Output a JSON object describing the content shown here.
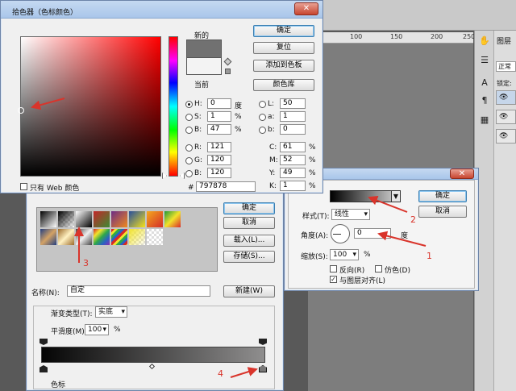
{
  "photoshop": {
    "ruler_ticks": [
      "100",
      "150",
      "200",
      "250"
    ],
    "tool_labels": [
      "A",
      "¶"
    ],
    "layers_labels": [
      "图层",
      "正常",
      "锁定:"
    ]
  },
  "color_picker": {
    "title": "拾色器（色标颜色）",
    "close_label": "✕",
    "new_label": "新的",
    "current_label": "当前",
    "buttons": {
      "ok": "确定",
      "reset": "复位",
      "add_to_swatches": "添加到色板",
      "color_libraries": "颜色库"
    },
    "web_only_label": "只有 Web 颜色",
    "new_color": "#717171",
    "current_color": "#f3f3f3",
    "hue_color": "#ff0000",
    "hsb": [
      {
        "key": "H:",
        "value": "0",
        "unit": "度",
        "selected": true
      },
      {
        "key": "S:",
        "value": "1",
        "unit": "%",
        "selected": false
      },
      {
        "key": "B:",
        "value": "47",
        "unit": "%",
        "selected": false
      }
    ],
    "rgb": [
      {
        "key": "R:",
        "value": "121"
      },
      {
        "key": "G:",
        "value": "120"
      },
      {
        "key": "B:",
        "value": "120"
      }
    ],
    "lab": [
      {
        "key": "L:",
        "value": "50"
      },
      {
        "key": "a:",
        "value": "1"
      },
      {
        "key": "b:",
        "value": "0"
      }
    ],
    "cmyk": [
      {
        "key": "C:",
        "value": "61",
        "unit": "%"
      },
      {
        "key": "M:",
        "value": "52",
        "unit": "%"
      },
      {
        "key": "Y:",
        "value": "49",
        "unit": "%"
      },
      {
        "key": "K:",
        "value": "1",
        "unit": "%"
      }
    ],
    "hex_label": "#",
    "hex_value": "797878"
  },
  "gradient_editor": {
    "buttons": {
      "ok": "确定",
      "cancel": "取消",
      "load": "载入(L)...",
      "save": "存储(S)...",
      "new": "新建(W)"
    },
    "name_label": "名称(N):",
    "name_value": "自定",
    "gradient_type_label": "渐变类型(T):",
    "gradient_type_value": "实底",
    "smoothness_label": "平滑度(M):",
    "smoothness_value": "100",
    "smoothness_unit": "%",
    "color_stops_label": "色标"
  },
  "gradient_overlay": {
    "close_label": "✕",
    "buttons": {
      "ok": "确定",
      "cancel": "取消"
    },
    "style_label": "样式(T):",
    "style_value": "线性",
    "angle_label": "角度(A):",
    "angle_value": "0",
    "angle_unit": "度",
    "scale_label": "缩放(S):",
    "scale_value": "100",
    "scale_unit": "%",
    "reverse_label": "反向(R)",
    "dither_label": "仿色(D)",
    "align_label": "与图层对齐(L)"
  },
  "annotations": [
    "1",
    "2",
    "3",
    "4"
  ]
}
